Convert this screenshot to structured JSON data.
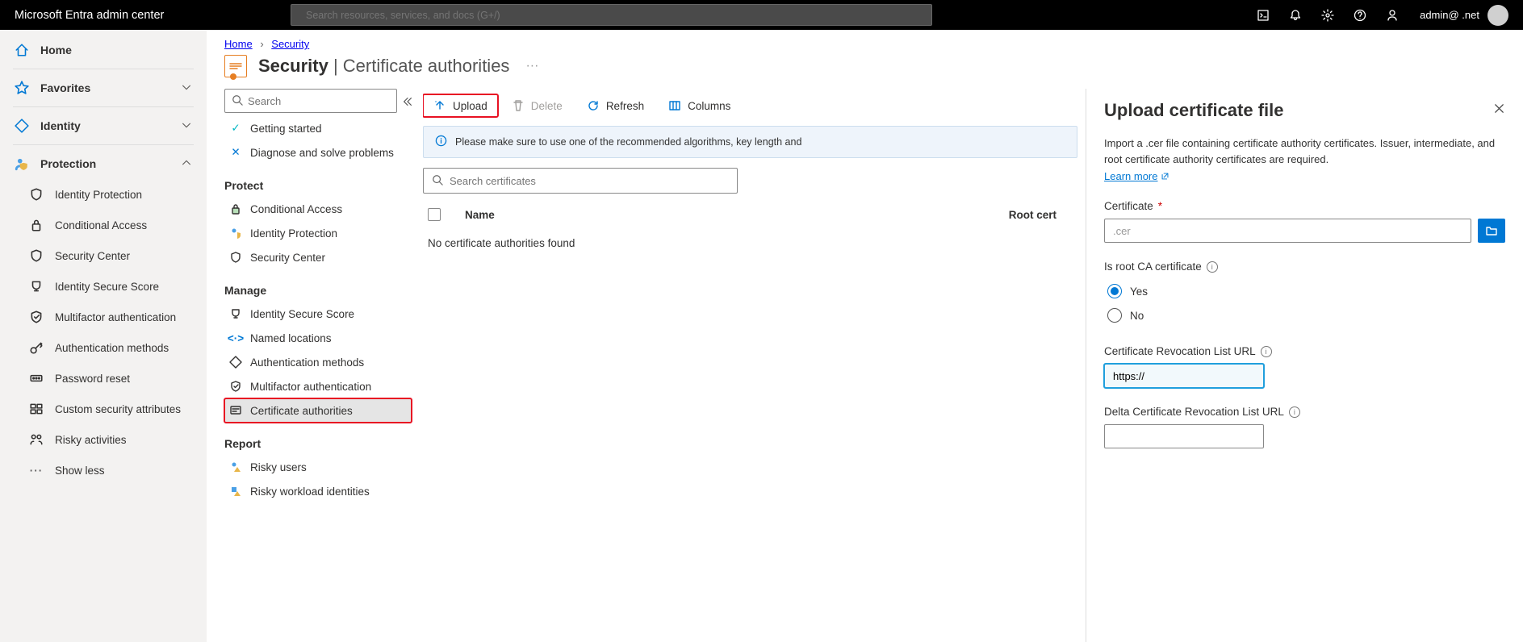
{
  "header": {
    "brand": "Microsoft Entra admin center",
    "search_placeholder": "Search resources, services, and docs (G+/)",
    "user": "admin@ .net"
  },
  "sidebar": {
    "items": [
      {
        "label": "Home",
        "icon": "home",
        "type": "top"
      },
      {
        "label": "Favorites",
        "icon": "star",
        "type": "top",
        "chev": "down"
      },
      {
        "label": "Identity",
        "icon": "diamond",
        "type": "top",
        "chev": "down"
      },
      {
        "label": "Protection",
        "icon": "user-shield",
        "type": "top",
        "chev": "up",
        "expanded": true
      },
      {
        "label": "Identity Protection",
        "icon": "shield"
      },
      {
        "label": "Conditional Access",
        "icon": "lock"
      },
      {
        "label": "Security Center",
        "icon": "shield-q"
      },
      {
        "label": "Identity Secure Score",
        "icon": "trophy"
      },
      {
        "label": "Multifactor authentication",
        "icon": "check-shield"
      },
      {
        "label": "Authentication methods",
        "icon": "key"
      },
      {
        "label": "Password reset",
        "icon": "password"
      },
      {
        "label": "Custom security attributes",
        "icon": "attributes"
      },
      {
        "label": "Risky activities",
        "icon": "risky-users"
      },
      {
        "label": "Show less",
        "icon": "dots"
      }
    ]
  },
  "breadcrumbs": [
    "Home",
    "Security"
  ],
  "title": {
    "main": "Security",
    "sub": "Certificate authorities"
  },
  "blade_nav": {
    "search_placeholder": "Search",
    "top": [
      {
        "label": "Getting started",
        "icon": "rocket"
      },
      {
        "label": "Diagnose and solve problems",
        "icon": "wrench"
      }
    ],
    "groups": [
      {
        "heading": "Protect",
        "items": [
          {
            "label": "Conditional Access",
            "icon": "lock-green"
          },
          {
            "label": "Identity Protection",
            "icon": "user-yellow"
          },
          {
            "label": "Security Center",
            "icon": "shield-blue"
          }
        ]
      },
      {
        "heading": "Manage",
        "items": [
          {
            "label": "Identity Secure Score",
            "icon": "trophy-orange"
          },
          {
            "label": "Named locations",
            "icon": "brackets"
          },
          {
            "label": "Authentication methods",
            "icon": "diamond-blue"
          },
          {
            "label": "Multifactor authentication",
            "icon": "shield-check"
          },
          {
            "label": "Certificate authorities",
            "icon": "certificate",
            "selected": true,
            "highlight": true
          }
        ]
      },
      {
        "heading": "Report",
        "items": [
          {
            "label": "Risky users",
            "icon": "risky-user"
          },
          {
            "label": "Risky workload identities",
            "icon": "risky-workload"
          }
        ]
      }
    ]
  },
  "toolbar": {
    "upload": "Upload",
    "delete": "Delete",
    "refresh": "Refresh",
    "columns": "Columns"
  },
  "info_bar": "Please make sure to use one of the recommended algorithms, key length and",
  "filter_placeholder": "Search certificates",
  "table": {
    "col_name": "Name",
    "col_root": "Root cert",
    "empty": "No certificate authorities found"
  },
  "panel": {
    "title": "Upload certificate file",
    "intro": "Import a .cer file containing certificate authority certificates. Issuer, intermediate, and root certificate authority certificates are required.",
    "learn": "Learn more",
    "cert_label": "Certificate",
    "cert_value": ".cer",
    "root_label": "Is root CA certificate",
    "opt_yes": "Yes",
    "opt_no": "No",
    "crl_label": "Certificate Revocation List URL",
    "crl_value": "https://",
    "delta_label": "Delta Certificate Revocation List URL",
    "delta_value": ""
  }
}
